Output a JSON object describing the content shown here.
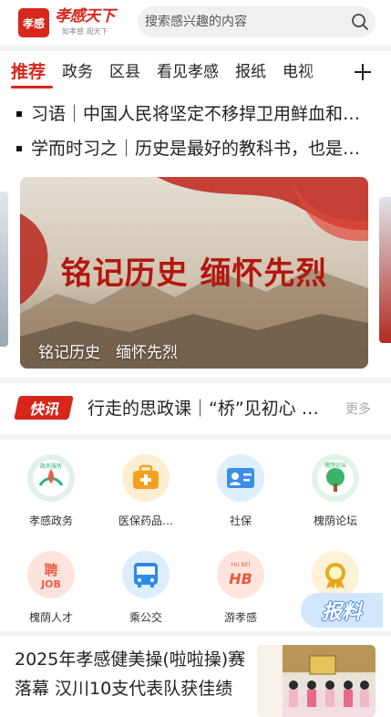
{
  "header": {
    "logo_icon": "xiaogan-seal-logo",
    "logo_seal_text": "孝感",
    "brand_name": "孝感天下",
    "brand_slogan": "知孝感 观天下",
    "search_placeholder": "搜索感兴趣的内容",
    "search_icon": "search-icon"
  },
  "tabs": {
    "items": [
      "推荐",
      "政务",
      "区县",
      "看见孝感",
      "报纸",
      "电视"
    ],
    "active_index": 0,
    "add_icon": "plus-icon"
  },
  "headlines": [
    "习语｜中国人民将坚定不移捍卫用鲜血和生命铸就的伟大胜利",
    "学而时习之｜历史是最好的教科书，也是最好的清醒剂"
  ],
  "banner": {
    "headline": "铭记历史 缅怀先烈",
    "caption": "铭记历史　缅怀先烈"
  },
  "flash": {
    "badge": "快讯",
    "text": "行走的思政课｜“桥”见初心 感悟信仰",
    "more": "更多"
  },
  "services": [
    {
      "label": "孝感政务",
      "icon": "gov-service-icon",
      "bg": "#dff1ea",
      "accent": "#2bb27a",
      "icon_text": "政务服务"
    },
    {
      "label": "医保药品…",
      "icon": "medical-kit-icon",
      "bg": "#fdeed2",
      "accent": "#f4a01f",
      "icon_text": ""
    },
    {
      "label": "社保",
      "icon": "id-card-icon",
      "bg": "#ddeefc",
      "accent": "#3a8fe6",
      "icon_text": ""
    },
    {
      "label": "槐荫论坛",
      "icon": "tree-forum-icon",
      "bg": "#e1f4e6",
      "accent": "#3db36a",
      "icon_text": "槐荫论坛"
    },
    {
      "label": "槐荫人才",
      "icon": "job-icon",
      "bg": "#fde3dc",
      "accent": "#e8604a",
      "icon_text": "聘 JOB"
    },
    {
      "label": "乘公交",
      "icon": "bus-icon",
      "bg": "#dcedfc",
      "accent": "#2d8ae6",
      "icon_text": ""
    },
    {
      "label": "游孝感",
      "icon": "travel-hubei-icon",
      "bg": "#fde5de",
      "accent": "#e8573c",
      "icon_text": "HU BEI"
    },
    {
      "label": "",
      "icon": "medal-icon",
      "bg": "#fdf1d6",
      "accent": "#e3a91c",
      "icon_text": ""
    }
  ],
  "report_button": "报料",
  "news": {
    "title": "2025年孝感健美操(啦啦操)赛落幕 汉川10支代表队获佳绩",
    "thumb_icon": "award-photo-thumbnail"
  }
}
